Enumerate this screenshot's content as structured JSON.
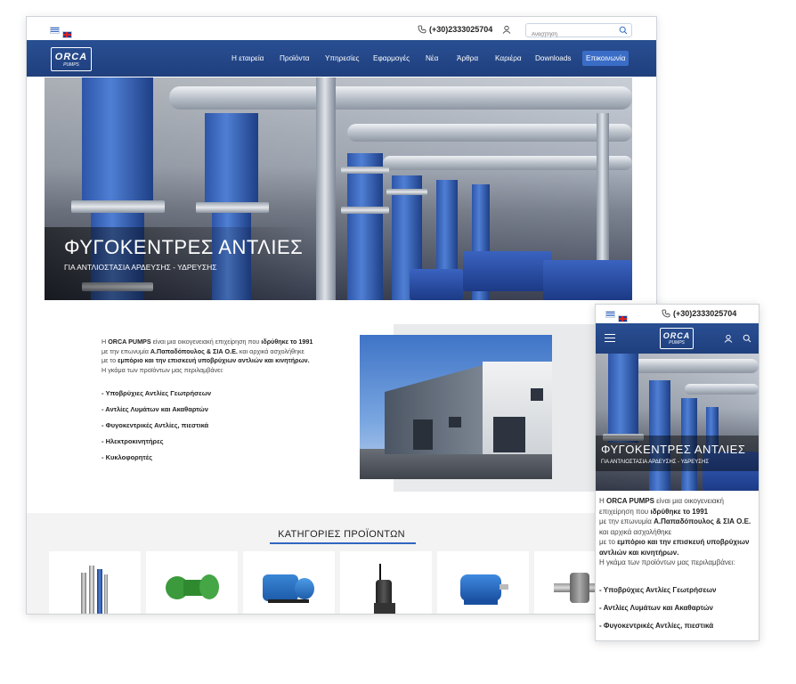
{
  "languages": [
    "greek-flag",
    "english-flag"
  ],
  "phone": "(+30)2333025704",
  "search": {
    "placeholder": "Αναζήτηση"
  },
  "logo": {
    "line1": "ORCA",
    "line2": "PUMPS"
  },
  "nav": [
    {
      "label": "Η εταιρεία"
    },
    {
      "label": "Προϊόντα"
    },
    {
      "label": "Υπηρεσίες"
    },
    {
      "label": "Εφαρμογές"
    },
    {
      "label": "Νέα"
    },
    {
      "label": "Άρθρα"
    },
    {
      "label": "Καριέρα"
    },
    {
      "label": "Downloads"
    },
    {
      "label": "Επικοινωνία"
    }
  ],
  "hero": {
    "title": "ΦΥΓΟΚΕΝΤΡΕΣ ΑΝΤΛΙΕΣ",
    "subtitle": "ΓΙΑ ΑΝΤΛΙΟΣΤΑΣΙΑ ΑΡΔΕΥΣΗΣ - ΥΔΡΕΥΣΗΣ"
  },
  "about": {
    "t1": "Η ",
    "company": "ORCA PUMPS",
    "t2": " είναι μια οικογενειακή επιχείρηση που ",
    "founded": "ιδρύθηκε το 1991",
    "t3": "με την επωνυμία ",
    "legal": "Α.Παπαδόπουλος & ΣΙΑ Ο.Ε.",
    "t4": " και αρχικά ασχολήθηκε",
    "t5": "με το ",
    "trade": "εμπόριο και την επισκευή υποβρύχιων αντλιών και κινητήρων.",
    "t6": "Η γκάμα των προϊόντων μας περιλαμβάνει:"
  },
  "products": [
    "- Υποβρύχιες Αντλίες Γεωτρήσεων",
    "- Αντλίες Λυμάτων και Ακαθαρτών",
    "- Φυγοκεντρικές Αντλίες, πιεστικά",
    "- Ηλεκτροκινητήρες",
    "- Κυκλοφορητές"
  ],
  "mobile_products": [
    "- Υποβρύχιες Αντλίες Γεωτρήσεων",
    "- Αντλίες Λυμάτων και Ακαθαρτών",
    "- Φυγοκεντρικές Αντλίες, πιεστικά"
  ],
  "categories": {
    "title": "ΚΑΤΗΓΟΡΙΕΣ ΠΡΟΪΟΝΤΩΝ",
    "items": [
      "submersible-pump-image",
      "sewage-pump-image",
      "centrifugal-pump-image",
      "grinder-pump-image",
      "electric-motor-image",
      "circulator-image"
    ]
  },
  "colors": {
    "nav": "#234585",
    "accent": "#2f67c0",
    "pump_blue": "#2d55a8"
  }
}
